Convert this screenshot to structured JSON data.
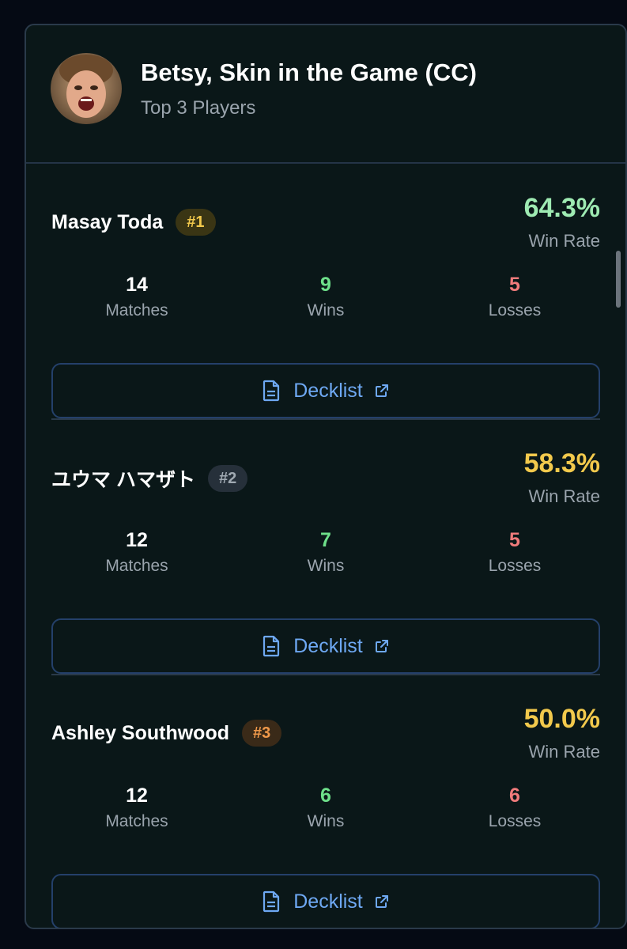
{
  "header": {
    "title": "Betsy, Skin in the Game (CC)",
    "subtitle": "Top 3 Players",
    "avatar_icon": "commander-portrait"
  },
  "colors": {
    "background": "#050a14",
    "card": "#0a1718",
    "win_green": "#6ee08a",
    "win_yellow": "#f2c94c",
    "loss_red": "#f07b7b",
    "link_blue": "#6ea8f2"
  },
  "players": [
    {
      "name": "Masay Toda",
      "rank": "#1",
      "win_rate": "64.3%",
      "win_rate_label": "Win Rate",
      "matches": "14",
      "matches_label": "Matches",
      "wins": "9",
      "wins_label": "Wins",
      "losses": "5",
      "losses_label": "Losses",
      "decklist_label": "Decklist"
    },
    {
      "name": "ユウマ ハマザト",
      "rank": "#2",
      "win_rate": "58.3%",
      "win_rate_label": "Win Rate",
      "matches": "12",
      "matches_label": "Matches",
      "wins": "7",
      "wins_label": "Wins",
      "losses": "5",
      "losses_label": "Losses",
      "decklist_label": "Decklist"
    },
    {
      "name": "Ashley Southwood",
      "rank": "#3",
      "win_rate": "50.0%",
      "win_rate_label": "Win Rate",
      "matches": "12",
      "matches_label": "Matches",
      "wins": "6",
      "wins_label": "Wins",
      "losses": "6",
      "losses_label": "Losses",
      "decklist_label": "Decklist"
    }
  ]
}
